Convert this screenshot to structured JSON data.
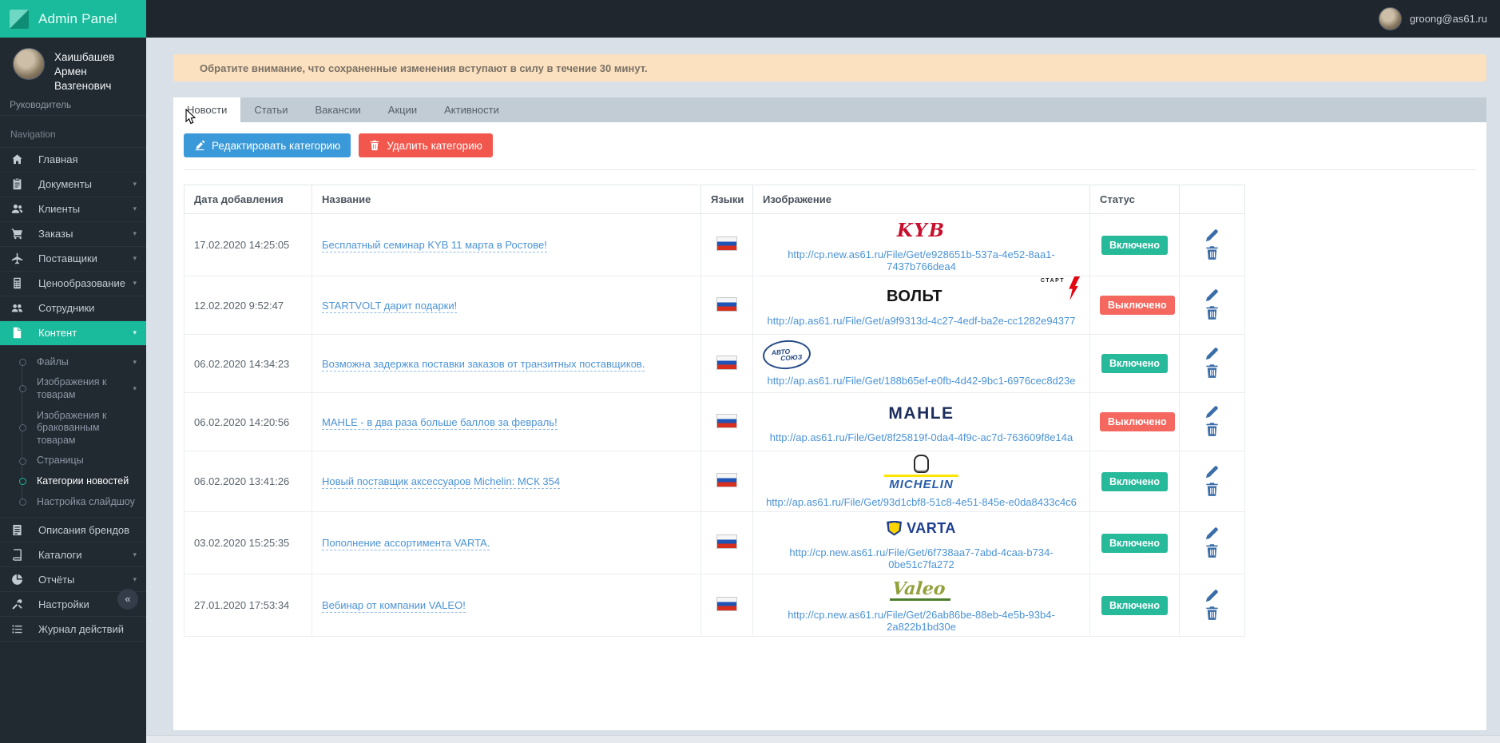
{
  "colors": {
    "accent": "#1abb9c",
    "status_on": "#26b99a",
    "status_off": "#f4685f",
    "primary_button": "#3a99d8",
    "danger_button": "#f2574d",
    "link": "#4b93d6"
  },
  "topbar": {
    "brand": "Admin Panel",
    "user_email": "groong@as61.ru"
  },
  "sidebar": {
    "user": {
      "name": "Хаишбашев Армен Вазгенович",
      "role": "Руководитель"
    },
    "section_label": "Navigation",
    "collapse_label": "«",
    "items": [
      {
        "label": "Главная",
        "icon": "home-icon",
        "chevron": false,
        "active": false
      },
      {
        "label": "Документы",
        "icon": "documents-icon",
        "chevron": true,
        "active": false
      },
      {
        "label": "Клиенты",
        "icon": "clients-icon",
        "chevron": true,
        "active": false
      },
      {
        "label": "Заказы",
        "icon": "orders-icon",
        "chevron": true,
        "active": false
      },
      {
        "label": "Поставщики",
        "icon": "suppliers-icon",
        "chevron": true,
        "active": false
      },
      {
        "label": "Ценообразование",
        "icon": "pricing-icon",
        "chevron": true,
        "active": false
      },
      {
        "label": "Сотрудники",
        "icon": "employees-icon",
        "chevron": false,
        "active": false
      },
      {
        "label": "Контент",
        "icon": "content-icon",
        "chevron": true,
        "active": true,
        "children": [
          {
            "label": "Файлы",
            "chevron": true,
            "active": false
          },
          {
            "label": "Изображения к товарам",
            "chevron": true,
            "active": false
          },
          {
            "label": "Изображения к бракованным товарам",
            "chevron": false,
            "active": false
          },
          {
            "label": "Страницы",
            "chevron": false,
            "active": false
          },
          {
            "label": "Категории новостей",
            "chevron": false,
            "active": true
          },
          {
            "label": "Настройка слайдшоу",
            "chevron": false,
            "active": false
          }
        ]
      },
      {
        "label": "Описания брендов",
        "icon": "brands-icon",
        "chevron": false,
        "active": false
      },
      {
        "label": "Каталоги",
        "icon": "catalogs-icon",
        "chevron": true,
        "active": false
      },
      {
        "label": "Отчёты",
        "icon": "reports-icon",
        "chevron": true,
        "active": false
      },
      {
        "label": "Настройки",
        "icon": "settings-icon",
        "chevron": true,
        "active": false
      },
      {
        "label": "Журнал действий",
        "icon": "log-icon",
        "chevron": false,
        "active": false
      }
    ]
  },
  "alert": {
    "text": "Обратите внимание, что сохраненные изменения вступают в силу в течение 30 минут."
  },
  "tabs": [
    {
      "label": "Новости",
      "active": true
    },
    {
      "label": "Статьи",
      "active": false
    },
    {
      "label": "Вакансии",
      "active": false
    },
    {
      "label": "Акции",
      "active": false
    },
    {
      "label": "Активности",
      "active": false
    }
  ],
  "actions": {
    "edit_label": "Редактировать категорию",
    "delete_label": "Удалить категорию"
  },
  "table": {
    "headers": [
      "Дата добавления",
      "Название",
      "Языки",
      "Изображение",
      "Статус",
      ""
    ],
    "rows": [
      {
        "date": "17.02.2020 14:25:05",
        "title": "Бесплатный семинар KYB 11 марта в Ростове!",
        "lang": "ru",
        "logo": {
          "type": "kyb",
          "text": "KYB",
          "sub": ""
        },
        "url": "http://cp.new.as61.ru/File/Get/e928651b-537a-4e52-8aa1-7437b766dea4",
        "status": "Включено",
        "enabled": true
      },
      {
        "date": "12.02.2020 9:52:47",
        "title": "STARTVOLT дарит подарки!",
        "lang": "ru",
        "logo": {
          "type": "startvolt",
          "text": "ВОЛЬТ",
          "sub": "СТАРТ"
        },
        "url": "http://ap.as61.ru/File/Get/a9f9313d-4c27-4edf-ba2e-cc1282e94377",
        "status": "Выключено",
        "enabled": false
      },
      {
        "date": "06.02.2020 14:34:23",
        "title": "Возможна задержка поставки заказов от транзитных поставщиков.",
        "lang": "ru",
        "logo": {
          "type": "avtosouz",
          "text": "АВТО",
          "sub": "СОЮЗ"
        },
        "url": "http://ap.as61.ru/File/Get/188b65ef-e0fb-4d42-9bc1-6976cec8d23e",
        "status": "Включено",
        "enabled": true
      },
      {
        "date": "06.02.2020 14:20:56",
        "title": "MAHLE - в два раза больше баллов за февраль!",
        "lang": "ru",
        "logo": {
          "type": "mahle",
          "text": "MAHLE",
          "sub": ""
        },
        "url": "http://ap.as61.ru/File/Get/8f25819f-0da4-4f9c-ac7d-763609f8e14a",
        "status": "Выключено",
        "enabled": false
      },
      {
        "date": "06.02.2020 13:41:26",
        "title": "Новый поставщик аксессуаров Michelin: МСК 354",
        "lang": "ru",
        "logo": {
          "type": "michelin",
          "text": "MICHELIN",
          "sub": ""
        },
        "url": "http://ap.as61.ru/File/Get/93d1cbf8-51c8-4e51-845e-e0da8433c4c6",
        "status": "Включено",
        "enabled": true
      },
      {
        "date": "03.02.2020 15:25:35",
        "title": "Пополнение ассортимента VARTA.",
        "lang": "ru",
        "logo": {
          "type": "varta",
          "text": "VARTA",
          "sub": ""
        },
        "url": "http://cp.new.as61.ru/File/Get/6f738aa7-7abd-4caa-b734-0be51c7fa272",
        "status": "Включено",
        "enabled": true
      },
      {
        "date": "27.01.2020 17:53:34",
        "title": "Вебинар от компании VALEO!",
        "lang": "ru",
        "logo": {
          "type": "valeo",
          "text": "Valeo",
          "sub": ""
        },
        "url": "http://cp.new.as61.ru/File/Get/26ab86be-88eb-4e5b-93b4-2a822b1bd30e",
        "status": "Включено",
        "enabled": true
      }
    ]
  }
}
